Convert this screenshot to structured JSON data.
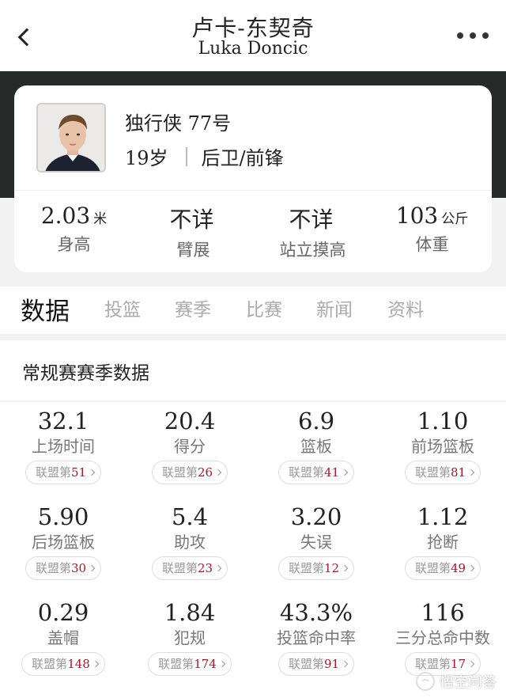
{
  "header": {
    "title_cn": "卢卡-东契奇",
    "title_en": "Luka Doncic"
  },
  "profile": {
    "team_number": "独行侠 77号",
    "age": "19岁",
    "position": "后卫/前锋",
    "metrics": [
      {
        "value": "2.03",
        "unit": "米",
        "label": "身高"
      },
      {
        "value": "不详",
        "unit": "",
        "label": "臂展"
      },
      {
        "value": "不详",
        "unit": "",
        "label": "站立摸高"
      },
      {
        "value": "103",
        "unit": "公斤",
        "label": "体重"
      }
    ]
  },
  "tabs": [
    "数据",
    "投篮",
    "赛季",
    "比赛",
    "新闻",
    "资料"
  ],
  "section_title": "常规赛赛季数据",
  "stats": [
    {
      "value": "32.1",
      "label": "上场时间",
      "rank_prefix": "联盟第",
      "rank": "51"
    },
    {
      "value": "20.4",
      "label": "得分",
      "rank_prefix": "联盟第",
      "rank": "26"
    },
    {
      "value": "6.9",
      "label": "篮板",
      "rank_prefix": "联盟第",
      "rank": "41"
    },
    {
      "value": "1.10",
      "label": "前场篮板",
      "rank_prefix": "联盟第",
      "rank": "81"
    },
    {
      "value": "5.90",
      "label": "后场篮板",
      "rank_prefix": "联盟第",
      "rank": "30"
    },
    {
      "value": "5.4",
      "label": "助攻",
      "rank_prefix": "联盟第",
      "rank": "23"
    },
    {
      "value": "3.20",
      "label": "失误",
      "rank_prefix": "联盟第",
      "rank": "12"
    },
    {
      "value": "1.12",
      "label": "抢断",
      "rank_prefix": "联盟第",
      "rank": "49"
    },
    {
      "value": "0.29",
      "label": "盖帽",
      "rank_prefix": "联盟第",
      "rank": "148"
    },
    {
      "value": "1.84",
      "label": "犯规",
      "rank_prefix": "联盟第",
      "rank": "174"
    },
    {
      "value": "43.3%",
      "label": "投篮命中率",
      "rank_prefix": "联盟第",
      "rank": "91"
    },
    {
      "value": "116",
      "label": "三分总命中数",
      "rank_prefix": "联盟第",
      "rank": "17"
    }
  ],
  "watermark": "悟空问答",
  "icons": {
    "back": "chevron-left-icon",
    "more": "more-dots-icon"
  }
}
